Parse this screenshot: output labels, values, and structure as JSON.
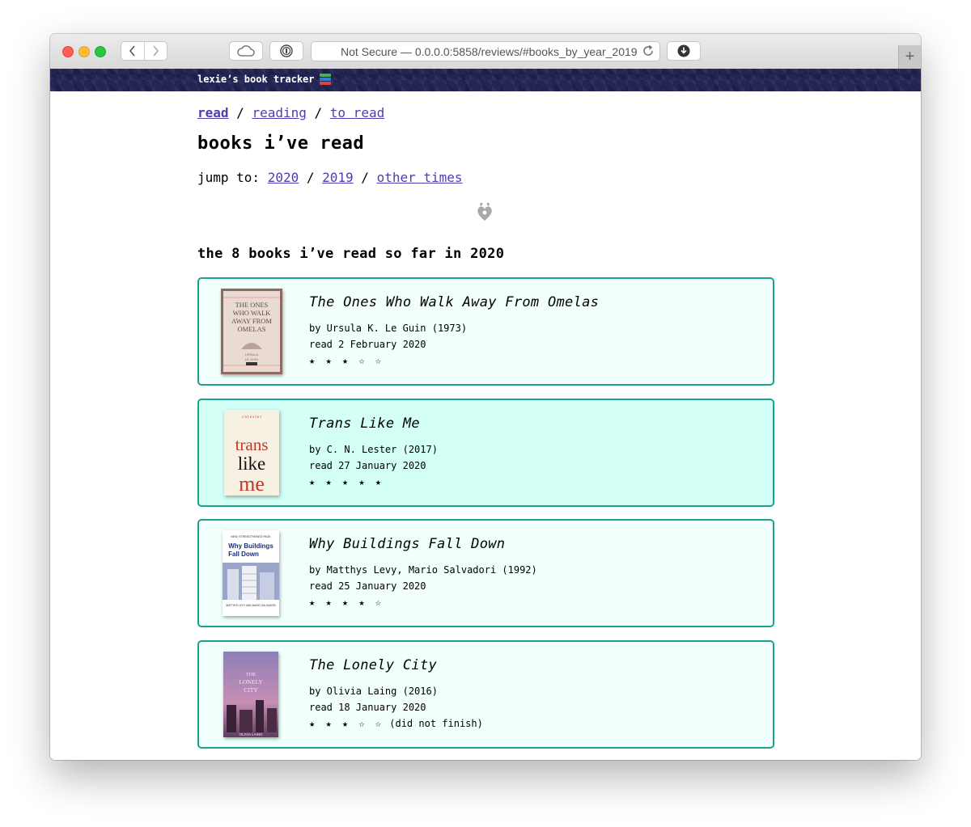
{
  "browser": {
    "address": "Not Secure — 0.0.0.0:5858/reviews/#books_by_year_2019",
    "new_tab": "+"
  },
  "site": {
    "title": "lexie’s book tracker"
  },
  "nav": {
    "read": "read",
    "sep1": " / ",
    "reading": "reading",
    "sep2": " / ",
    "to_read": "to read"
  },
  "heading": "books i’ve read",
  "jump": {
    "label": "jump to: ",
    "y2020": "2020",
    "sep1": " / ",
    "y2019": "2019",
    "sep2": " / ",
    "other": "other times"
  },
  "section_heading": "the 8 books i’ve read so far in 2020",
  "books": [
    {
      "title": "The Ones Who Walk Away From Omelas",
      "byline": "by Ursula K. Le Guin (1973)",
      "read_date": "read 2 February 2020",
      "rating": 3,
      "stars": "★ ★ ★ ☆ ☆",
      "note": "",
      "cover_text": [
        "THE ONES",
        "WHO WALK",
        "AWAY FROM",
        "OMELAS",
        "URSULA",
        "LE GUIN"
      ]
    },
    {
      "title": "Trans Like Me",
      "byline": "by C. N. Lester (2017)",
      "read_date": "read 27 January 2020",
      "rating": 5,
      "stars": "★ ★ ★ ★ ★",
      "note": "",
      "cover_text": [
        "c n l e s t e r",
        "trans",
        "like",
        "me"
      ]
    },
    {
      "title": "Why Buildings Fall Down",
      "byline": "by Matthys Levy, Mario Salvadori (1992)",
      "read_date": "read 25 January 2020",
      "rating": 4,
      "stars": "★ ★ ★ ★ ☆",
      "note": "",
      "cover_text": [
        "NEW, STRENGTHENED PAGE",
        "Why Buildings",
        "Fall Down",
        "MATTHYS LEVY AND MARIO SALVADORI"
      ]
    },
    {
      "title": "The Lonely City",
      "byline": "by Olivia Laing (2016)",
      "read_date": "read 18 January 2020",
      "rating": 3,
      "stars": "★ ★ ★ ☆ ☆",
      "note": " (did not finish)",
      "cover_text": [
        "THE",
        "LONELY",
        "CITY",
        "OLIVIA LAING"
      ]
    }
  ],
  "colors": {
    "banner": "#232655",
    "link": "#4a3fb3",
    "card_border": "#1aa38b",
    "card_bg": "#f1fffd",
    "card_highlight": "#d3fff7"
  }
}
